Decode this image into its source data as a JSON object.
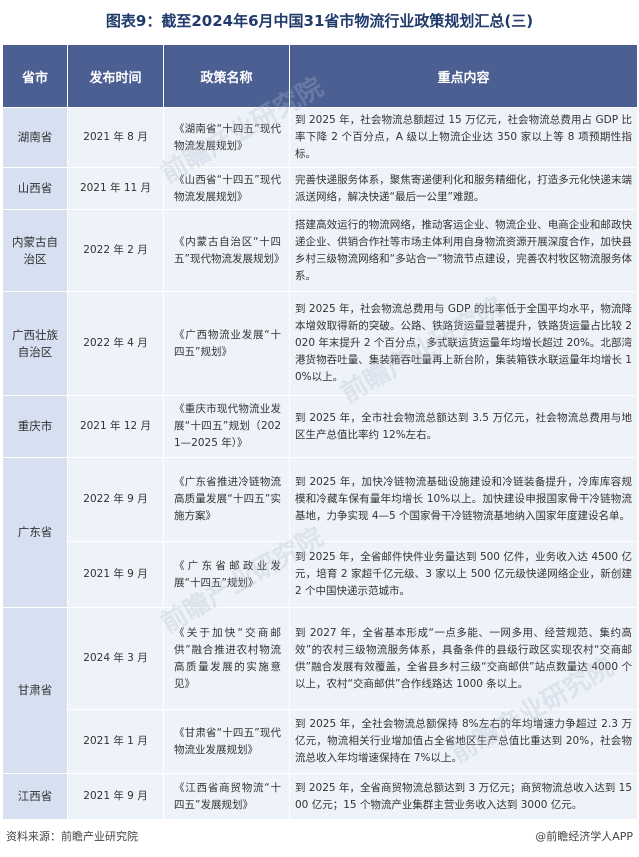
{
  "title": "图表9：截至2024年6月中国31省市物流行业政策规划汇总(三)",
  "headers": {
    "province": "省市",
    "date": "发布时间",
    "policy": "政策名称",
    "content": "重点内容"
  },
  "rows": [
    {
      "province": "湖南省",
      "date": "2021 年 8 月",
      "policy": "《湖南省“十四五”现代物流发展规划》",
      "content": "到 2025 年，社会物流总额超过 15 万亿元，社会物流总费用占 GDP 比率下降 2 个百分点，A 级以上物流企业达 350 家以上等 8 项预期性指标。"
    },
    {
      "province": "山西省",
      "date": "2021 年 11 月",
      "policy": "《山西省“十四五”现代物流发展规划》",
      "content": "完善快递服务体系，聚焦寄递便利化和服务精细化，打造多元化快递末端派送网络，解决快递“最后一公里”难题。"
    },
    {
      "province": "内蒙古自治区",
      "date": "2022 年 2 月",
      "policy": "《内蒙古自治区“十四五”现代物流发展规划》",
      "content": "搭建高效运行的物流网络，推动客运企业、物流企业、电商企业和邮政快递企业、供销合作社等市场主体利用自身物流资源开展深度合作，加快县乡村三级物流网络和“多站合一”物流节点建设，完善农村牧区物流服务体系。"
    },
    {
      "province": "广西壮族自治区",
      "date": "2022 年 4 月",
      "policy": "《广西物流业发展“十四五”规划》",
      "content": "到 2025 年，社会物流总费用与 GDP 的比率低于全国平均水平，物流降本增效取得新的突破。公路、铁路货运量显著提升，铁路货运量占比较 2020 年末提升 2 个百分点，多式联运货运量年均增长超过 20%。北部湾港货物吞吐量、集装箱吞吐量再上新台阶，集装箱铁水联运量年均增长 10%以上。"
    },
    {
      "province": "重庆市",
      "date": "2021 年 12 月",
      "policy": "《重庆市现代物流业发展“十四五”规划（2021—2025 年）》",
      "content": "到 2025 年，全市社会物流总额达到 3.5 万亿元，社会物流总费用与地区生产总值比率约 12%左右。"
    },
    {
      "province": "广东省",
      "date": "2022 年 9 月",
      "policy": "《广东省推进冷链物流高质量发展“十四五”实施方案》",
      "content": "到 2025 年，加快冷链物流基础设施建设和冷链装备提升，冷库库容规模和冷藏车保有量年均增长 10%以上。加快建设申报国家骨干冷链物流基地，力争实现 4—5 个国家骨干冷链物流基地纳入国家年度建设名单。"
    },
    {
      "province": "",
      "date": "2021 年 9 月",
      "policy": "《广东省邮政业发展“十四五”规划》",
      "content": "到 2025 年，全省邮件快件业务量达到 500 亿件，业务收入达 4500 亿元，培育 2 家超千亿元级、3 家以上 500 亿元级快递网络企业，新创建 2 个中国快递示范城市。"
    },
    {
      "province": "甘肃省",
      "date": "2024 年 3 月",
      "policy": "《关于加快“交商邮供”融合推进农村物流高质量发展的实施意见》",
      "content": "到 2027 年，全省基本形成“一点多能、一网多用、经营规范、集约高效”的农村三级物流服务体系，具备条件的县级行政区实现农村“交商邮供”融合发展有效覆盖，全省县乡村三级“交商邮供”站点数量达 4000 个以上，农村“交商邮供”合作线路达 1000 条以上。"
    },
    {
      "province": "",
      "date": "2021 年 1 月",
      "policy": "《甘肃省“十四五”现代物流业发展规划》",
      "content": "到 2025 年，全社会物流总额保持 8%左右的年均增速力争超过 2.3 万亿元，物流相关行业增加值占全省地区生产总值比重达到 20%，社会物流总收入年均增速保持在 7%以上。"
    },
    {
      "province": "江西省",
      "date": "2021 年 9 月",
      "policy": "《江西省商贸物流“十四五”发展规划》",
      "content": "到 2025 年，全省商贸物流总额达到 3 万亿元；商贸物流总收入达到 1500 亿元；15 个物流产业集群主营业务收入达到 3000 亿元。"
    }
  ],
  "footer": {
    "source": "资料来源：前瞻产业研究院",
    "brand": "@前瞻经济学人APP"
  },
  "watermark": "前瞻产业研究院"
}
